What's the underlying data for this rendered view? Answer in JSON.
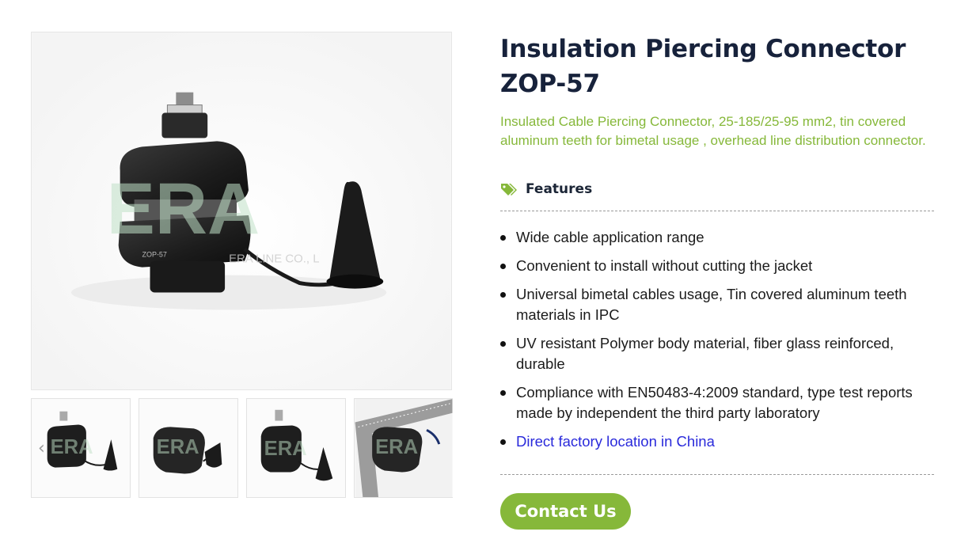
{
  "product": {
    "title": "Insulation Piercing Connector ZOP-57",
    "subtitle": "Insulated Cable Piercing Connector, 25-185/25-95 mm2, tin covered aluminum teeth for bimetal usage , overhead line distribution connector."
  },
  "gallery": {
    "main_image_watermark": "ERA",
    "main_image_watermark_sub": "ERA LINE CO., L",
    "main_image_model_label": "ZOP-57",
    "prev_icon": "chevron-left-icon",
    "thumbnails": [
      {
        "alt": "ZOP-57 front view"
      },
      {
        "alt": "ZOP-57 side view"
      },
      {
        "alt": "ZOP-57 angled view"
      },
      {
        "alt": "ZOP-57 with ruler"
      }
    ]
  },
  "features": {
    "icon": "tag-icon",
    "label": "Features",
    "items": [
      "Wide cable application range",
      "Convenient to install without cutting the jacket",
      "Universal bimetal cables usage, Tin covered aluminum teeth materials in IPC",
      "UV resistant Polymer body material, fiber glass reinforced, durable",
      "Compliance with EN50483-4:2009 standard, type test reports made by independent the third party laboratory"
    ],
    "link_item": "Direct factory location in China"
  },
  "cta": {
    "contact_label": "Contact Us"
  },
  "colors": {
    "accent_green": "#86b83a",
    "title_navy": "#17223b",
    "link_blue": "#2a2adb"
  }
}
